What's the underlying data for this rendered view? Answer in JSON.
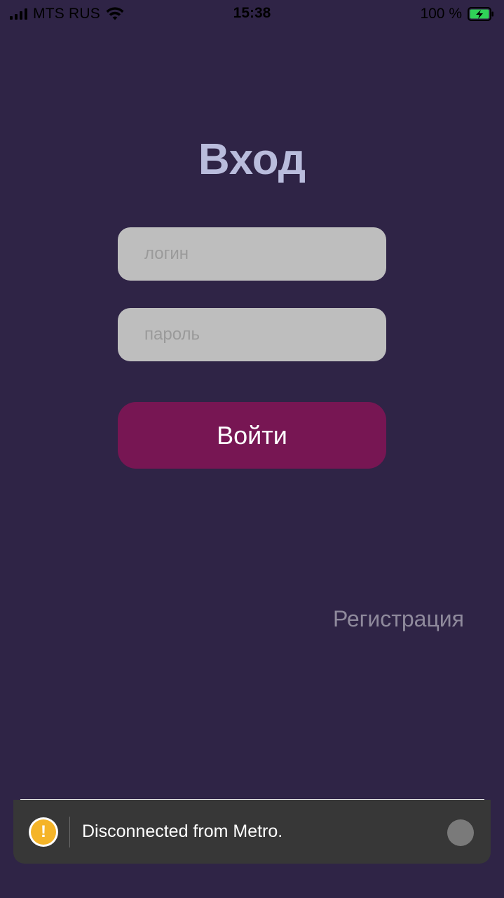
{
  "status_bar": {
    "carrier": "MTS RUS",
    "time": "15:38",
    "battery": "100 %",
    "battery_level": 1.0,
    "battery_color": "#30d158",
    "icons": [
      "signal-icon",
      "wifi-icon",
      "battery-charging-icon"
    ]
  },
  "screen": {
    "title": "Вход",
    "login_placeholder": "логин",
    "password_placeholder": "пароль",
    "submit_label": "Войти",
    "register_label": "Регистрация"
  },
  "toast": {
    "message": "Disconnected from Metro.",
    "icon": "warning-icon",
    "icon_glyph": "!",
    "dismiss_icon": "dismiss-icon"
  },
  "colors": {
    "background": "#2f2446",
    "title": "#b9bcdc",
    "input_background": "#bebebe",
    "button": "#771653",
    "register_link": "#8f8a9c",
    "toast_background": "#373737",
    "warning": "#f5b428"
  }
}
